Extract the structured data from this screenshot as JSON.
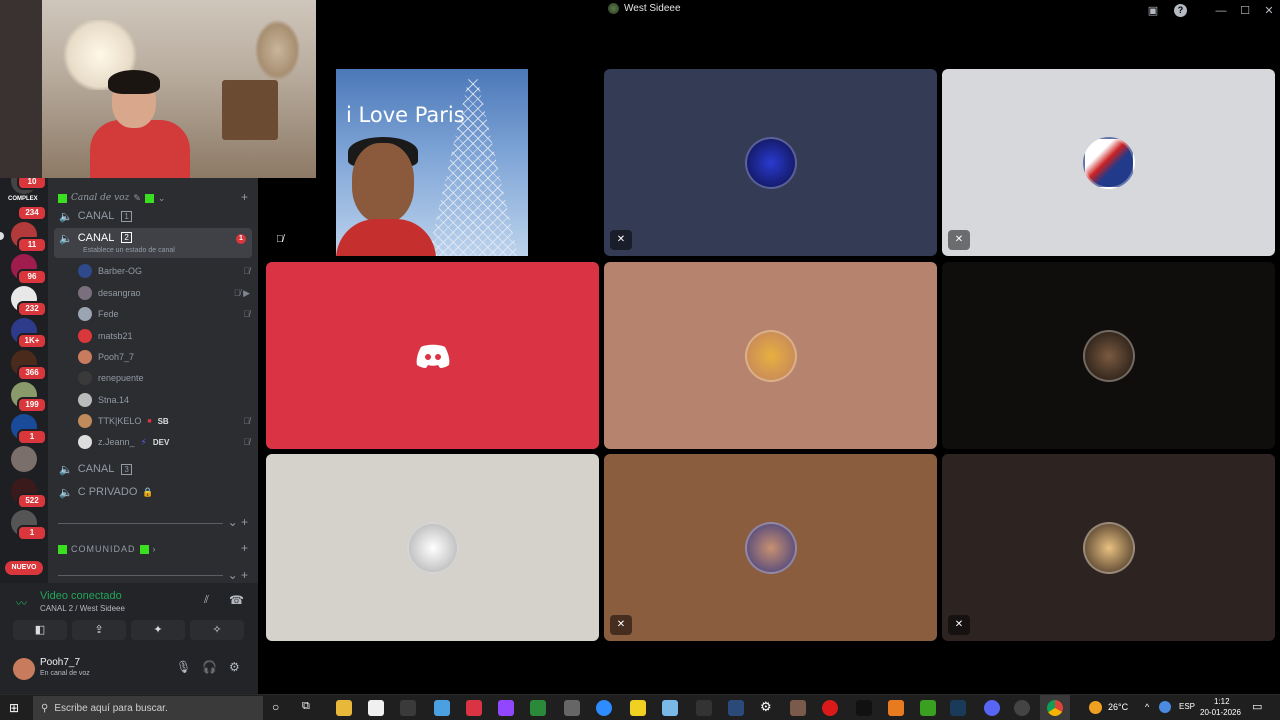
{
  "window": {
    "title": "West Sideee",
    "help": "?",
    "minimize": "—",
    "maximize": "☐",
    "close": "✕"
  },
  "servers": [
    {
      "badge": "10"
    },
    {
      "badge": "234"
    },
    {
      "badge": "11"
    },
    {
      "badge": "96"
    },
    {
      "badge": "232"
    },
    {
      "badge": "1K+"
    },
    {
      "badge": "366"
    },
    {
      "badge": "199"
    },
    {
      "badge": "1"
    },
    {
      "badge": "522"
    },
    {
      "badge": "1"
    }
  ],
  "complex_label": "COMPLEX",
  "nuevo": "NUEVO",
  "channels": {
    "category_voice": "Canal de voz",
    "canal1": {
      "name": "CANAL",
      "num": "1"
    },
    "canal2": {
      "name": "CANAL",
      "num": "2",
      "sub": "Establece un estado de canal",
      "badge": "1"
    },
    "canal3": {
      "name": "CANAL",
      "num": "3"
    },
    "cprivado": "C PRIVADO",
    "category2": "COMUNIDAD",
    "users": [
      {
        "name": "Barber-OG",
        "icons": "🎙̸",
        "color": "#2e4a8a"
      },
      {
        "name": "desangrao",
        "icons": "🎙̸ ▶",
        "color": "#7a6f7d"
      },
      {
        "name": "Fede",
        "icons": "🎙̸",
        "color": "#9aa4b2"
      },
      {
        "name": "matsb21",
        "icons": "",
        "color": "#da373c"
      },
      {
        "name": "Pooh7_7",
        "icons": "",
        "color": "#c97c5d"
      },
      {
        "name": "renepuente",
        "icons": "",
        "color": "#3a3a3a"
      },
      {
        "name": "Stna.14",
        "icons": "",
        "color": "#bbb"
      },
      {
        "name": "TTK|KELO",
        "tag": "SB",
        "icons": "🎙̸",
        "color": "#c08a5a"
      },
      {
        "name": "z.Jeann_",
        "tag": "DEV",
        "icons": "🎙̸",
        "color": "#ddd"
      }
    ]
  },
  "voice": {
    "status": "Video conectado",
    "location": "CANAL 2 / West Sideee"
  },
  "userbar": {
    "name": "Pooh7_7",
    "status": "En canal de voz"
  },
  "tiles": {
    "paris_text": "i Love Paris",
    "colors": {
      "blue": "#343b55",
      "light": "#d7d8dc",
      "red": "#da3444",
      "tan": "#b5836e",
      "dark": "#0f0e0c",
      "grey": "#d5d1cb",
      "brown": "#8a5d3f",
      "darkbrown": "#2d2422"
    }
  },
  "taskbar": {
    "search": "Escribe aquí para buscar.",
    "temp": "26°C",
    "lang": "ESP",
    "time": "1:12",
    "date": "20-01-2026"
  }
}
